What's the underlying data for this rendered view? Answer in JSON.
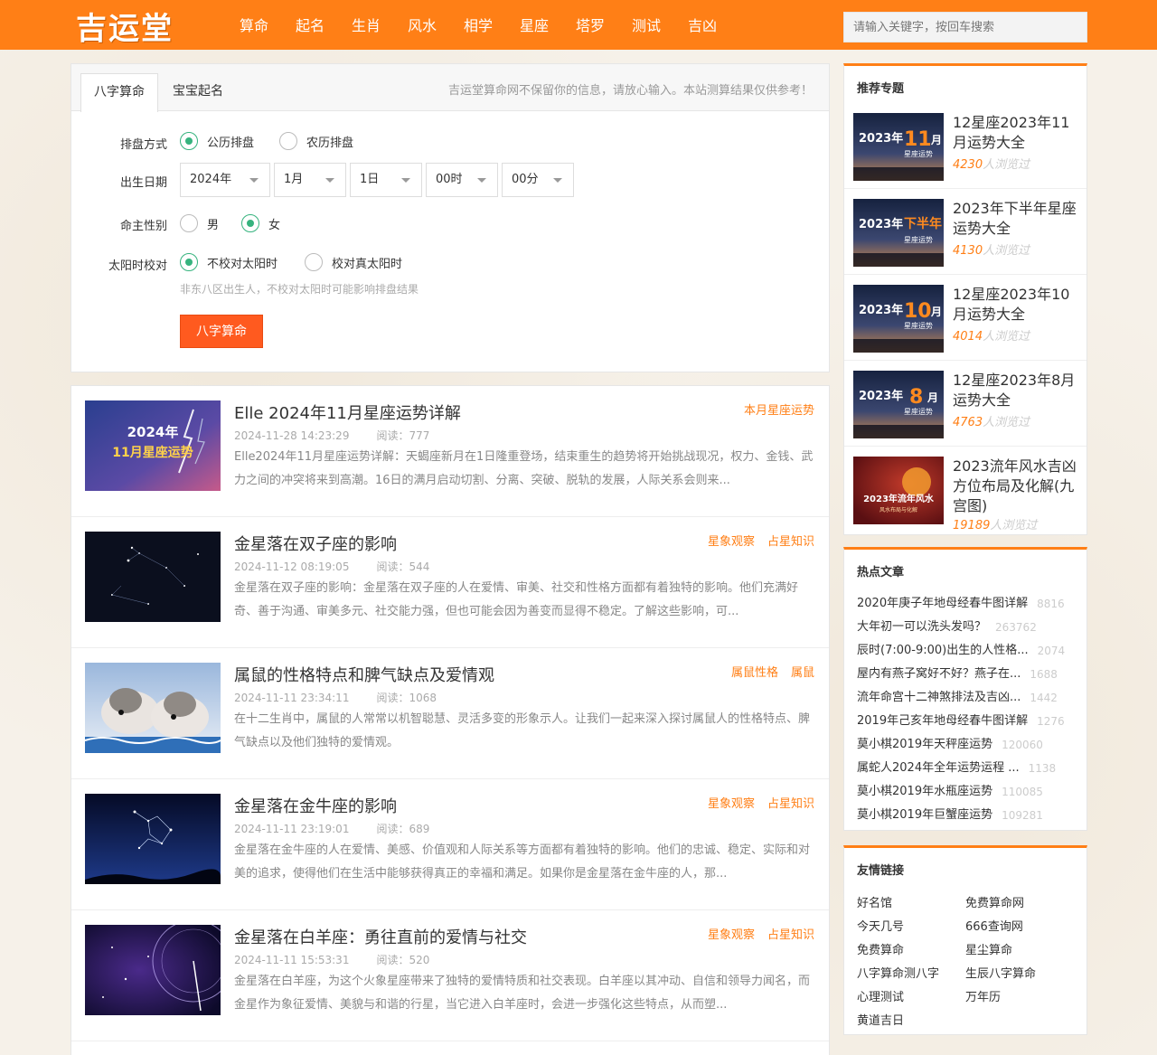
{
  "header": {
    "logo": "吉运堂",
    "nav": [
      "算命",
      "起名",
      "生肖",
      "风水",
      "相学",
      "星座",
      "塔罗",
      "测试",
      "吉凶"
    ],
    "search_placeholder": "请输入关键字，按回车搜索"
  },
  "calc": {
    "tabs": [
      "八字算命",
      "宝宝起名"
    ],
    "notice": "吉运堂算命网不保留你的信息，请放心输入。本站测算结果仅供参考！",
    "mode_label": "排盘方式",
    "mode_opts": [
      "公历排盘",
      "农历排盘"
    ],
    "date_label": "出生日期",
    "year": "2024年",
    "month": "1月",
    "day": "1日",
    "hour": "00时",
    "minute": "00分",
    "gender_label": "命主性别",
    "gender_opts": [
      "男",
      "女"
    ],
    "solar_label": "太阳时校对",
    "solar_opts": [
      "不校对太阳时",
      "校对真太阳时"
    ],
    "hint": "非东八区出生人，不校对太阳时可能影响排盘结果",
    "submit": "八字算命"
  },
  "articles": [
    {
      "title": "Elle 2024年11月星座运势详解",
      "tags": [
        "本月星座运势"
      ],
      "date": "2024-11-28 14:23:29",
      "reads": "阅读：777",
      "desc": "Elle2024年11月星座运势详解：天蝎座新月在1日隆重登场，结束重生的趋势将开始挑战现况，权力、金钱、武力之间的冲突将来到高潮。16日的满月启动切割、分离、突破、脱轨的发展，人际关系会则来...",
      "thumb_text": [
        "2024年",
        "11月星座运势"
      ]
    },
    {
      "title": "金星落在双子座的影响",
      "tags": [
        "星象观察",
        "占星知识"
      ],
      "date": "2024-11-12 08:19:05",
      "reads": "阅读：544",
      "desc": "金星落在双子座的影响：金星落在双子座的人在爱情、审美、社交和性格方面都有着独特的影响。他们充满好奇、善于沟通、审美多元、社交能力强，但也可能会因为善变而显得不稳定。了解这些影响，可..."
    },
    {
      "title": "属鼠的性格特点和脾气缺点及爱情观",
      "tags": [
        "属鼠性格",
        "属鼠"
      ],
      "date": "2024-11-11 23:34:11",
      "reads": "阅读：1068",
      "desc": "在十二生肖中，属鼠的人常常以机智聪慧、灵活多变的形象示人。让我们一起来深入探讨属鼠人的性格特点、脾气缺点以及他们独特的爱情观。"
    },
    {
      "title": "金星落在金牛座的影响",
      "tags": [
        "星象观察",
        "占星知识"
      ],
      "date": "2024-11-11 23:19:01",
      "reads": "阅读：689",
      "desc": "金星落在金牛座的人在爱情、美感、价值观和人际关系等方面都有着独特的影响。他们的忠诚、稳定、实际和对美的追求，使得他们在生活中能够获得真正的幸福和满足。如果你是金星落在金牛座的人，那..."
    },
    {
      "title": "金星落在白羊座：勇往直前的爱情与社交",
      "tags": [
        "星象观察",
        "占星知识"
      ],
      "date": "2024-11-11 15:53:31",
      "reads": "阅读：520",
      "desc": "金星落在白羊座，为这个火象星座带来了独特的爱情特质和社交表现。白羊座以其冲动、自信和领导力闻名，而金星作为象征爱情、美貌与和谐的行星，当它进入白羊座时，会进一步强化这些特点，从而塑..."
    }
  ],
  "sidebar": {
    "topics_title": "推荐专题",
    "topics": [
      {
        "title": "12星座2023年11月运势大全",
        "views": "4230",
        "suffix": "人浏览过",
        "badge": "11",
        "sub": "星座运势",
        "year": "2023年",
        "unit": "月"
      },
      {
        "title": "2023年下半年星座运势大全",
        "views": "4130",
        "suffix": "人浏览过",
        "badge": "下半年",
        "sub": "星座运势",
        "year": "2023年",
        "unit": ""
      },
      {
        "title": "12星座2023年10月运势大全",
        "views": "4014",
        "suffix": "人浏览过",
        "badge": "10",
        "sub": "星座运势",
        "year": "2023年",
        "unit": "月"
      },
      {
        "title": "12星座2023年8月运势大全",
        "views": "4763",
        "suffix": "人浏览过",
        "badge": "8",
        "sub": "星座运势",
        "year": "2023年",
        "unit": "月"
      },
      {
        "title": "2023流年风水吉凶方位布局及化解(九宫图)",
        "views": "19189",
        "suffix": "人浏览过",
        "badge": "2023年流年风水",
        "sub": "风水布局与化解",
        "year": "",
        "unit": ""
      }
    ],
    "hot_title": "热点文章",
    "hot": [
      {
        "t": "2020年庚子年地母经春牛图详解",
        "c": "8816"
      },
      {
        "t": "大年初一可以洗头发吗？",
        "c": "263762"
      },
      {
        "t": "辰时(7:00-9:00)出生的人性格...",
        "c": "2074"
      },
      {
        "t": "屋内有燕子窝好不好？燕子在...",
        "c": "1688"
      },
      {
        "t": "流年命宫十二神煞排法及吉凶...",
        "c": "1442"
      },
      {
        "t": "2019年己亥年地母经春牛图详解",
        "c": "1276"
      },
      {
        "t": "莫小棋2019年天秤座运势",
        "c": "120060"
      },
      {
        "t": "属蛇人2024年全年运势运程 ...",
        "c": "1138"
      },
      {
        "t": "莫小棋2019年水瓶座运势",
        "c": "110085"
      },
      {
        "t": "莫小棋2019年巨蟹座运势",
        "c": "109281"
      }
    ],
    "links_title": "友情链接",
    "links": [
      "好名馆",
      "免费算命网",
      "今天几号",
      "666查询网",
      "免费算命",
      "星尘算命",
      "八字算命测八字",
      "生辰八字算命",
      "心理测试",
      "万年历",
      "黄道吉日"
    ]
  }
}
